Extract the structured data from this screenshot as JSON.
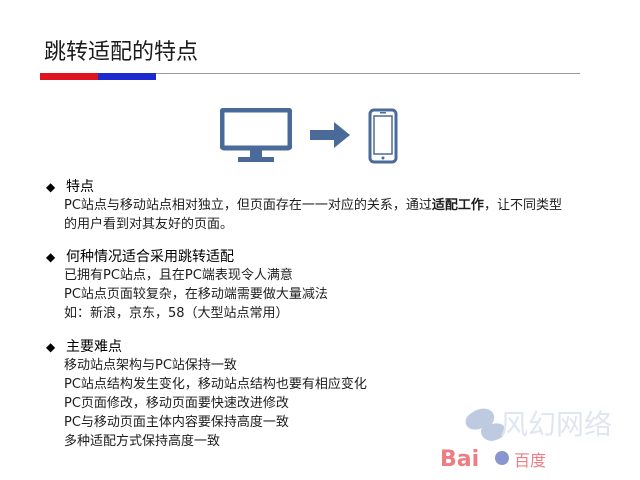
{
  "title": "跳转适配的特点",
  "sections": [
    {
      "heading": "特点",
      "lines": [
        {
          "part1": "PC站点与移动站点相对独立，但页面存在一一对应的关系，通过",
          "bold": "适配工作",
          "part2": "，让不同类型的用户看到对其友好的页面。"
        }
      ]
    },
    {
      "heading": "何种情况适合采用跳转适配",
      "lines": [
        "已拥有PC站点，且在PC端表现令人满意",
        "PC站点页面较复杂，在移动端需要做大量减法",
        "如：新浪，京东，58（大型站点常用）"
      ]
    },
    {
      "heading": "主要难点",
      "lines": [
        "移动站点架构与PC站保持一致",
        "PC站点结构发生变化，移动站点结构也要有相应变化",
        "PC页面修改，移动页面要快速改进修改",
        "PC与移动页面主体内容要保持高度一致",
        "多种适配方式保持高度一致"
      ]
    }
  ],
  "icons": [
    "desktop-monitor-icon",
    "right-arrow-icon",
    "smartphone-icon"
  ],
  "watermark": {
    "brand": "Bai",
    "text": "百度",
    "cursive": "风幻网络"
  },
  "colors": {
    "accent_red": "#e0141e",
    "accent_blue": "#1b2bd0",
    "icon_blue": "#4a6a9a"
  }
}
